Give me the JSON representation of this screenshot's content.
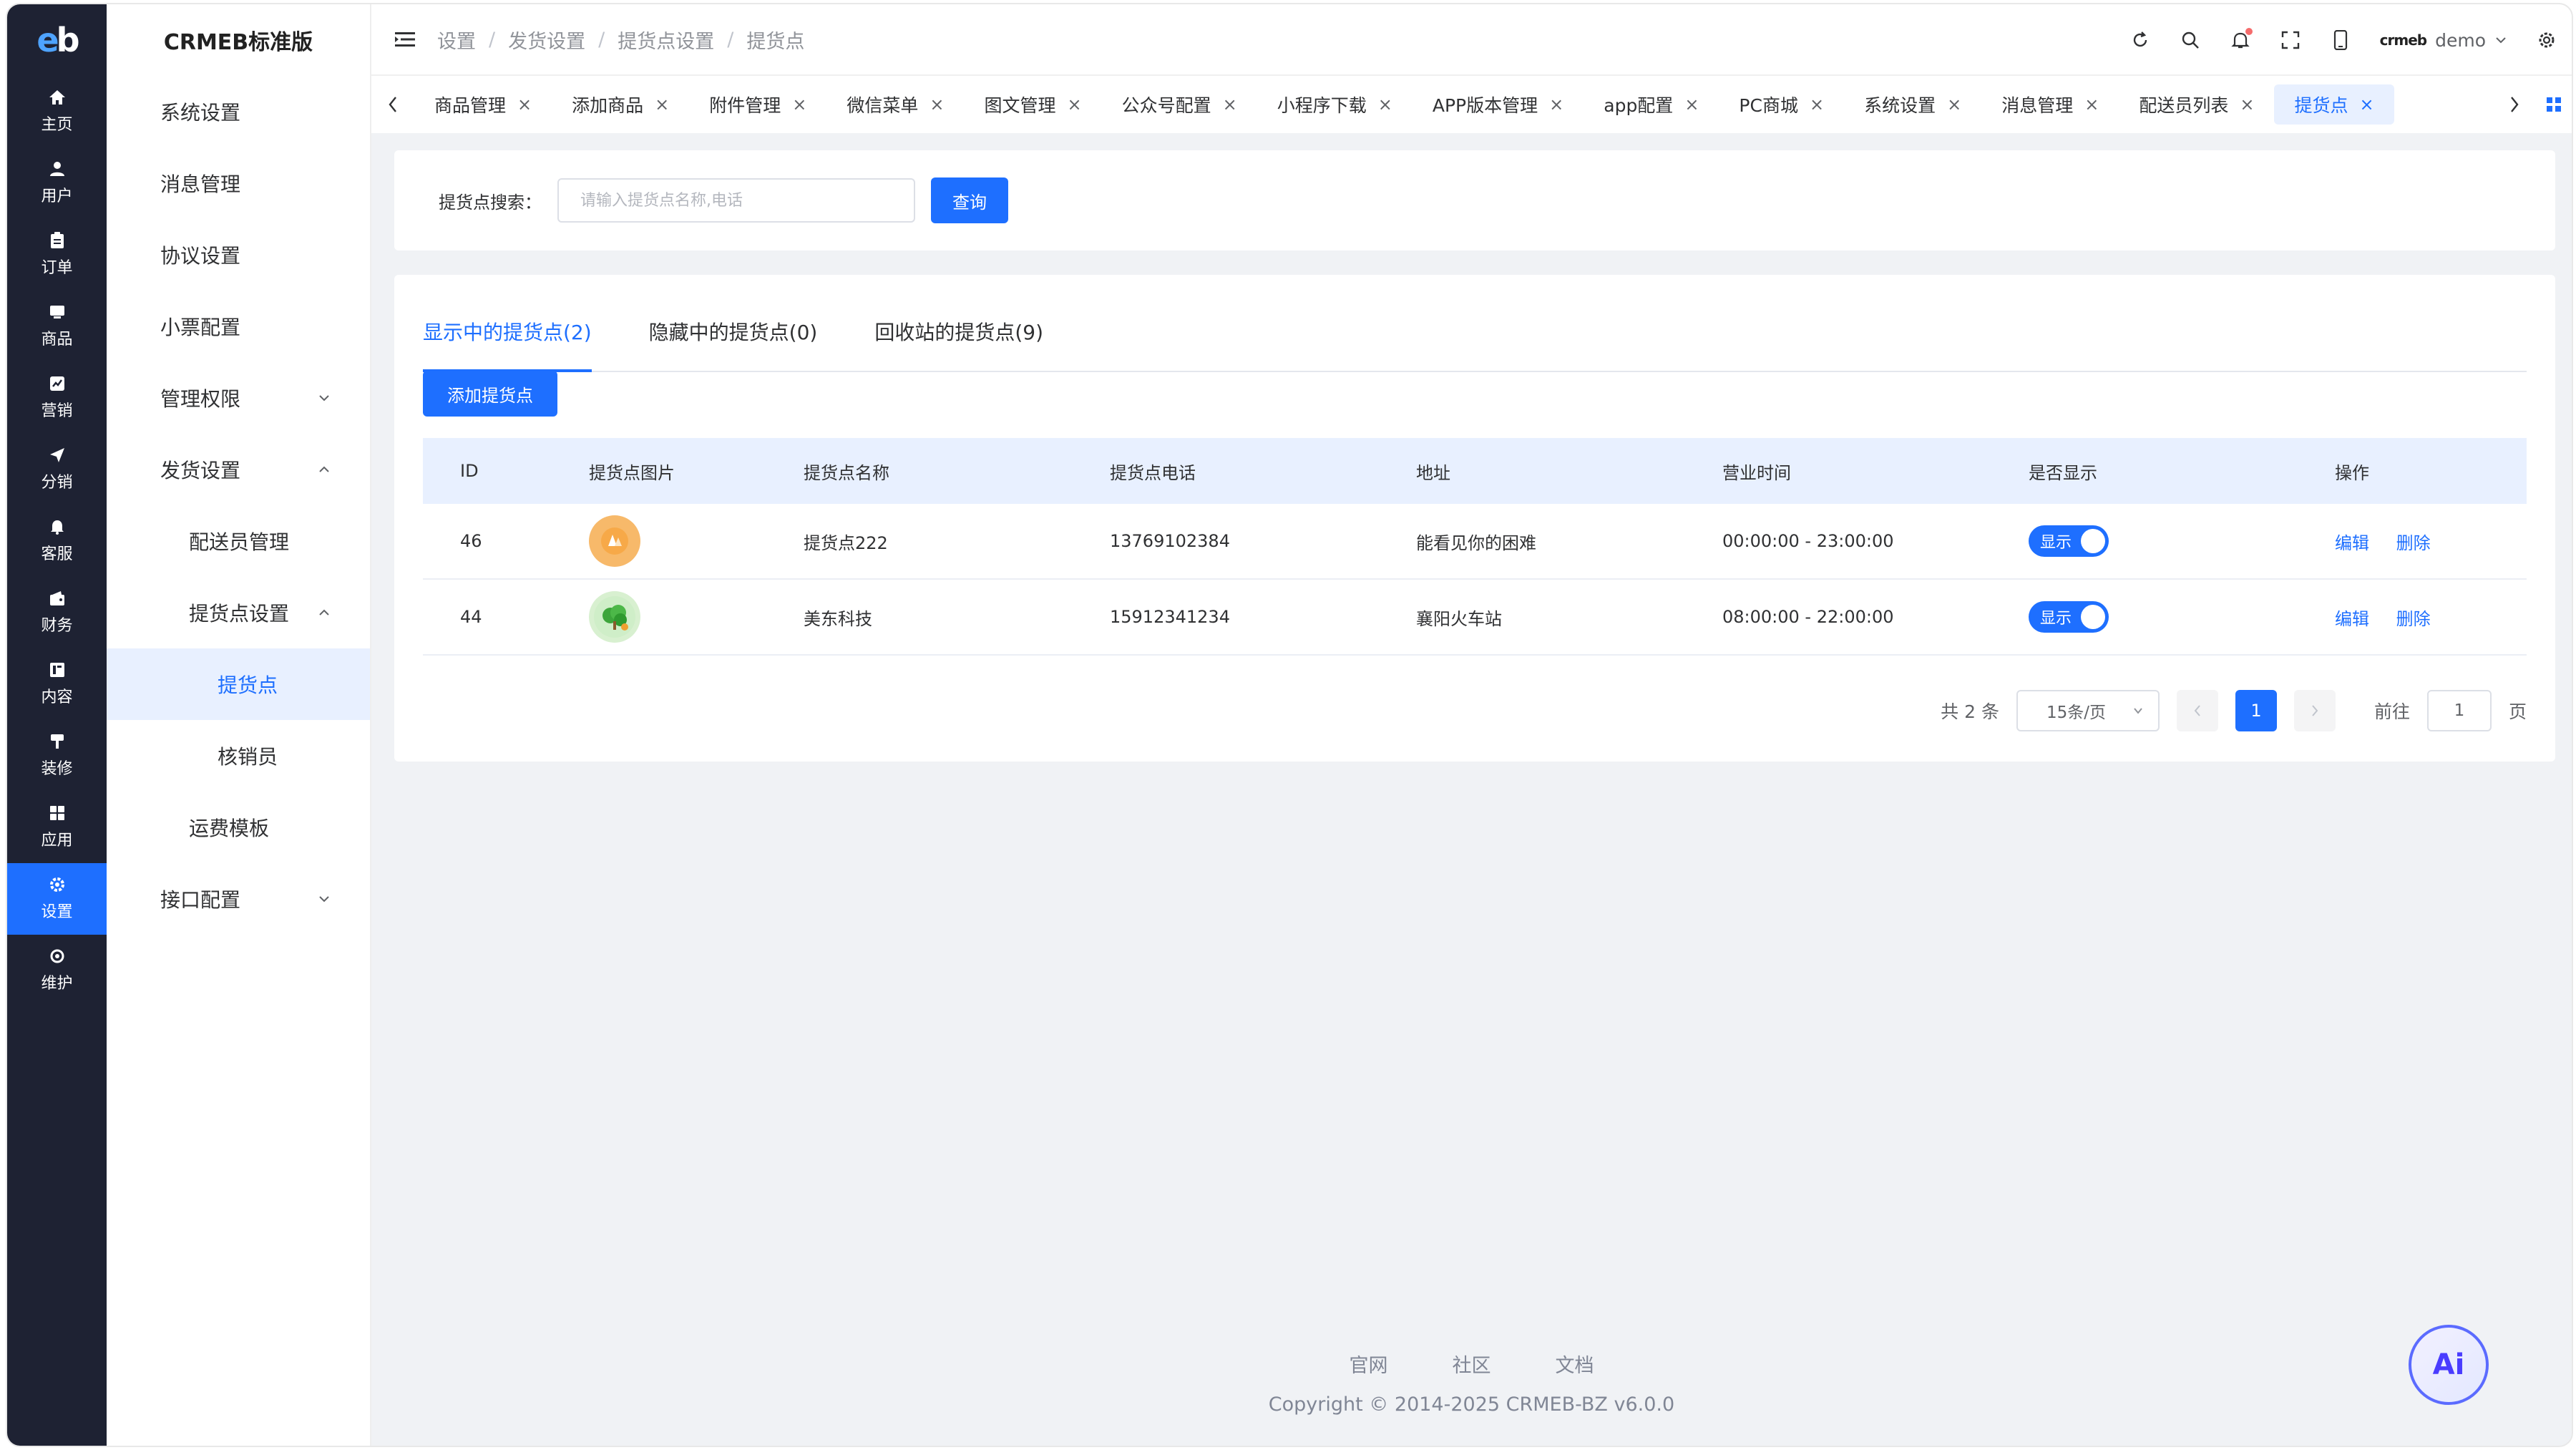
{
  "brand": {
    "logo_text": "eb",
    "title": "CRMEB标准版"
  },
  "rail": [
    {
      "label": "主页",
      "icon": "home-icon"
    },
    {
      "label": "用户",
      "icon": "user-icon"
    },
    {
      "label": "订单",
      "icon": "order-icon"
    },
    {
      "label": "商品",
      "icon": "product-icon"
    },
    {
      "label": "营销",
      "icon": "marketing-icon"
    },
    {
      "label": "分销",
      "icon": "distribution-icon"
    },
    {
      "label": "客服",
      "icon": "service-bell-icon"
    },
    {
      "label": "财务",
      "icon": "finance-icon"
    },
    {
      "label": "内容",
      "icon": "content-icon"
    },
    {
      "label": "装修",
      "icon": "decorate-icon"
    },
    {
      "label": "应用",
      "icon": "apps-icon"
    },
    {
      "label": "设置",
      "icon": "gear-icon"
    },
    {
      "label": "维护",
      "icon": "maintain-icon"
    }
  ],
  "sidebar": {
    "items": [
      {
        "label": "系统设置"
      },
      {
        "label": "消息管理"
      },
      {
        "label": "协议设置"
      },
      {
        "label": "小票配置"
      },
      {
        "label": "管理权限"
      },
      {
        "label": "发货设置"
      },
      {
        "label": "配送员管理"
      },
      {
        "label": "提货点设置"
      },
      {
        "label": "提货点"
      },
      {
        "label": "核销员"
      },
      {
        "label": "运费模板"
      },
      {
        "label": "接口配置"
      }
    ]
  },
  "breadcrumb": [
    "设置",
    "发货设置",
    "提货点设置",
    "提货点"
  ],
  "header": {
    "username": "demo",
    "mini_logo": "crmeb"
  },
  "tabs": [
    {
      "label": "商品管理"
    },
    {
      "label": "添加商品"
    },
    {
      "label": "附件管理"
    },
    {
      "label": "微信菜单"
    },
    {
      "label": "图文管理"
    },
    {
      "label": "公众号配置"
    },
    {
      "label": "小程序下载"
    },
    {
      "label": "APP版本管理"
    },
    {
      "label": "app配置"
    },
    {
      "label": "PC商城"
    },
    {
      "label": "系统设置"
    },
    {
      "label": "消息管理"
    },
    {
      "label": "配送员列表"
    },
    {
      "label": "提货点"
    }
  ],
  "search": {
    "label": "提货点搜索：",
    "placeholder": "请输入提货点名称,电话",
    "button": "查询"
  },
  "state_tabs": [
    "显示中的提货点(2)",
    "隐藏中的提货点(0)",
    "回收站的提货点(9)"
  ],
  "add_button": "添加提货点",
  "table": {
    "headers": [
      "ID",
      "提货点图片",
      "提货点名称",
      "提货点电话",
      "地址",
      "营业时间",
      "是否显示",
      "操作"
    ],
    "rows": [
      {
        "id": "46",
        "name": "提货点222",
        "phone": "13769102384",
        "address": "能看见你的困难",
        "hours": "00:00:00 - 23:00:00",
        "show": "显示",
        "edit": "编辑",
        "delete": "删除"
      },
      {
        "id": "44",
        "name": "美东科技",
        "phone": "15912341234",
        "address": "襄阳火车站",
        "hours": "08:00:00 - 22:00:00",
        "show": "显示",
        "edit": "编辑",
        "delete": "删除"
      }
    ]
  },
  "pagination": {
    "total": "共 2 条",
    "page_size": "15条/页",
    "current": "1",
    "goto_label": "前往",
    "goto_value": "1",
    "page_unit": "页"
  },
  "footer": {
    "links": [
      "官网",
      "社区",
      "文档"
    ],
    "copyright": "Copyright © 2014-2025 CRMEB-BZ v6.0.0"
  },
  "ai_button": "Ai",
  "colors": {
    "accent": "#1e6fff",
    "rail_bg": "#1e2233",
    "active_bg": "#e8f0ff"
  }
}
